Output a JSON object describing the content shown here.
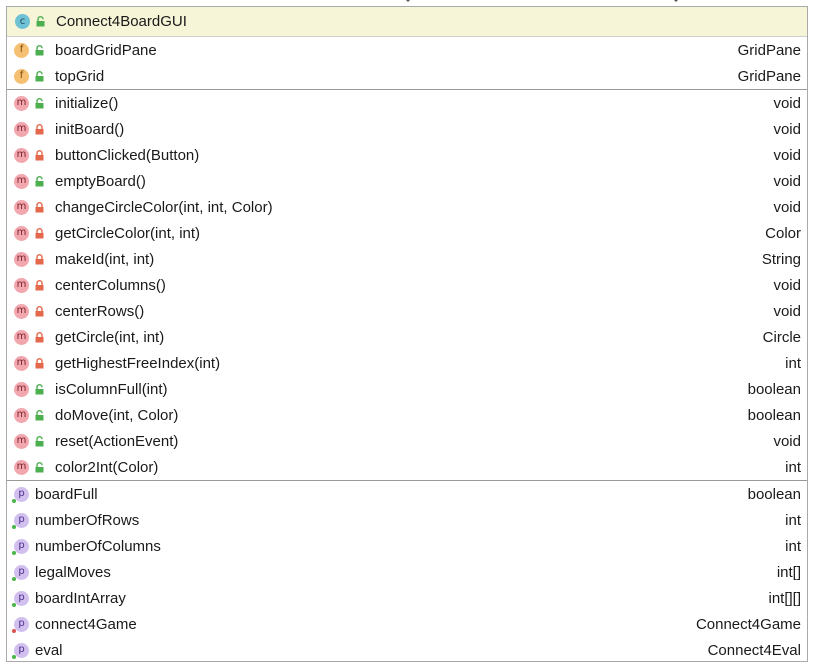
{
  "class": {
    "icon": "class-icon",
    "name": "Connect4BoardGUI"
  },
  "fields": [
    {
      "name": "boardGridPane",
      "type": "GridPane",
      "visibility": "public"
    },
    {
      "name": "topGrid",
      "type": "GridPane",
      "visibility": "public"
    }
  ],
  "methods": [
    {
      "name": "initialize()",
      "type": "void",
      "visibility": "public"
    },
    {
      "name": "initBoard()",
      "type": "void",
      "visibility": "private"
    },
    {
      "name": "buttonClicked(Button)",
      "type": "void",
      "visibility": "private"
    },
    {
      "name": "emptyBoard()",
      "type": "void",
      "visibility": "public"
    },
    {
      "name": "changeCircleColor(int, int, Color)",
      "type": "void",
      "visibility": "private"
    },
    {
      "name": "getCircleColor(int, int)",
      "type": "Color",
      "visibility": "private"
    },
    {
      "name": "makeId(int, int)",
      "type": "String",
      "visibility": "private"
    },
    {
      "name": "centerColumns()",
      "type": "void",
      "visibility": "private"
    },
    {
      "name": "centerRows()",
      "type": "void",
      "visibility": "private"
    },
    {
      "name": "getCircle(int, int)",
      "type": "Circle",
      "visibility": "private"
    },
    {
      "name": "getHighestFreeIndex(int)",
      "type": "int",
      "visibility": "private"
    },
    {
      "name": "isColumnFull(int)",
      "type": "boolean",
      "visibility": "public"
    },
    {
      "name": "doMove(int, Color)",
      "type": "boolean",
      "visibility": "public"
    },
    {
      "name": "reset(ActionEvent)",
      "type": "void",
      "visibility": "public"
    },
    {
      "name": "color2Int(Color)",
      "type": "int",
      "visibility": "public"
    }
  ],
  "properties": [
    {
      "name": "boardFull",
      "type": "boolean",
      "visibility": "public"
    },
    {
      "name": "numberOfRows",
      "type": "int",
      "visibility": "public"
    },
    {
      "name": "numberOfColumns",
      "type": "int",
      "visibility": "public"
    },
    {
      "name": "legalMoves",
      "type": "int[]",
      "visibility": "public"
    },
    {
      "name": "boardIntArray",
      "type": "int[][]",
      "visibility": "public"
    },
    {
      "name": "connect4Game",
      "type": "Connect4Game",
      "visibility": "private"
    },
    {
      "name": "eval",
      "type": "Connect4Eval",
      "visibility": "public"
    }
  ],
  "glyphs": {
    "class": "c",
    "field": "f",
    "method": "m",
    "property": "p"
  },
  "colors": {
    "header_bg": "#f6f5d8",
    "class_icon": "#6fc1d6",
    "field_icon": "#f6c072",
    "method_icon": "#f2a7ae",
    "property_icon": "#d1c0ee",
    "public_lock": "#4caf50",
    "private_lock": "#e4684c"
  }
}
